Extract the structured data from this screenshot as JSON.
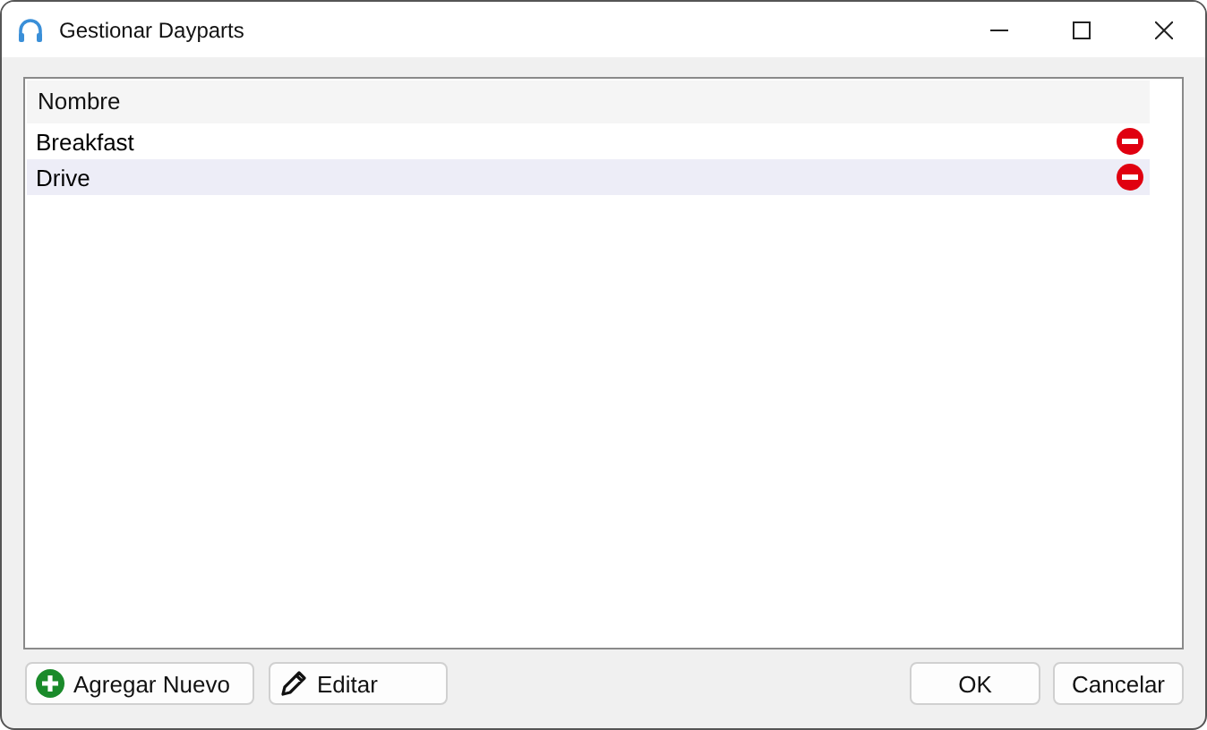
{
  "window": {
    "title": "Gestionar Dayparts"
  },
  "table": {
    "columns": [
      "Nombre"
    ],
    "rows": [
      {
        "name": "Breakfast",
        "selected": false
      },
      {
        "name": "Drive",
        "selected": true
      }
    ]
  },
  "buttons_left": [
    {
      "label": "Agregar Nuevo",
      "kind": "add"
    },
    {
      "label": "Editar",
      "kind": "edit"
    }
  ],
  "buttons_right": [
    "OK",
    "Cancelar"
  ]
}
